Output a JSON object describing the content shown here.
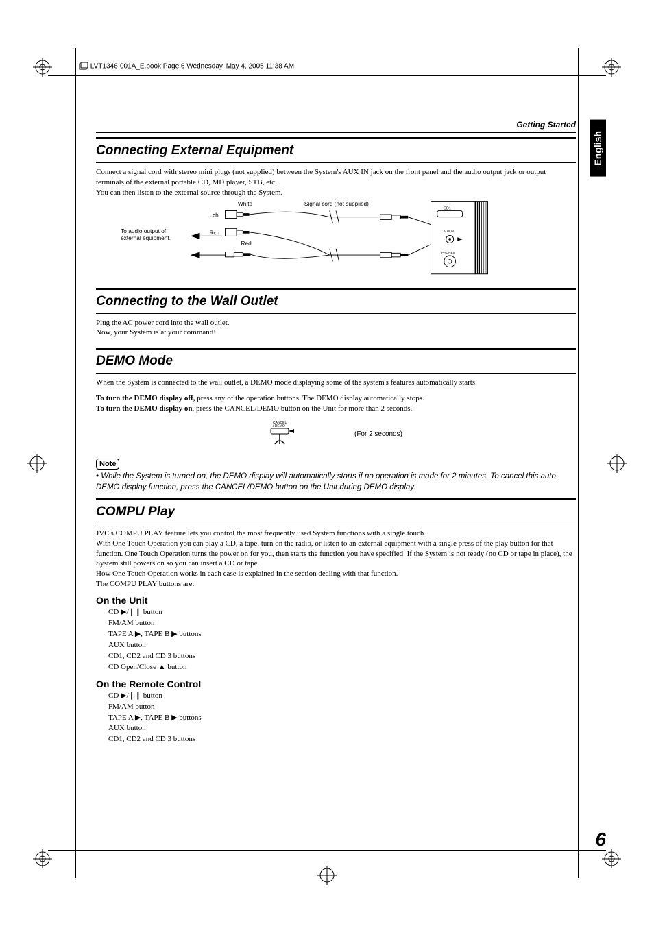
{
  "print_header": "LVT1346-001A_E.book  Page 6  Wednesday, May 4, 2005  11:38 AM",
  "running_header": "Getting Started",
  "side_tab": "English",
  "page_number": "6",
  "sections": {
    "connecting_ext": {
      "title": "Connecting External Equipment",
      "para": "Connect a signal cord with stereo mini plugs (not supplied) between the System's AUX IN jack on the front panel and the audio output jack or output terminals of the external portable CD, MD player, STB, etc.\nYou can then listen to the external source through the System.",
      "diagram": {
        "label_audio_out": "To audio output of external equipment.",
        "lch": "Lch",
        "rch": "Rch",
        "white": "White",
        "red": "Red",
        "signal_cord": "Signal cord (not supplied)",
        "panel_cd1": "CD1",
        "panel_aux": "AUX IN",
        "panel_phones": "PHONES"
      }
    },
    "wall_outlet": {
      "title": "Connecting to the Wall Outlet",
      "para": "Plug the AC power cord into the wall outlet.\nNow, your System is at your command!"
    },
    "demo": {
      "title": "DEMO Mode",
      "para1": "When the System is connected to the wall outlet, a DEMO mode displaying some of the system's features automatically starts.",
      "bold_off": "To turn the DEMO display off,",
      "off_rest": " press any of the operation buttons. The DEMO display automatically stops.",
      "bold_on": "To turn the DEMO display on",
      "on_rest": ", press the CANCEL/DEMO button on the Unit for more than 2 seconds.",
      "button_label": "CANCEL / DEMO",
      "for2sec": "(For 2 seconds)",
      "note_label": "Note",
      "note_body": "• While the System is turned on, the DEMO display will automatically starts if no operation is made for 2 minutes. To cancel this auto DEMO display function, press the CANCEL/DEMO button on the Unit during DEMO display."
    },
    "compu": {
      "title": "COMPU Play",
      "para": "JVC's COMPU PLAY feature lets you control the most frequently used System functions with a single touch.\nWith One Touch Operation you can play a CD, a tape, turn on the radio, or listen to an external equipment with a single press of the play button for that function. One Touch Operation turns the power on for you, then starts the function you have specified. If the System is not ready (no CD or tape in place), the System still powers on so you can insert a CD or tape.\nHow One Touch Operation works in each case is explained in the section dealing with that function.\nThe COMPU PLAY buttons are:",
      "on_unit_heading": "On the Unit",
      "unit_items": [
        "CD ▶/❙❙ button",
        "FM/AM button",
        "TAPE A ▶, TAPE B ▶ buttons",
        "AUX button",
        "CD1, CD2 and CD 3 buttons",
        "CD Open/Close ▲ button"
      ],
      "on_remote_heading": "On the Remote Control",
      "remote_items": [
        "CD ▶/❙❙ button",
        "FM/AM button",
        "TAPE A ▶, TAPE B ▶ buttons",
        "AUX button",
        "CD1, CD2 and CD 3 buttons"
      ]
    }
  }
}
